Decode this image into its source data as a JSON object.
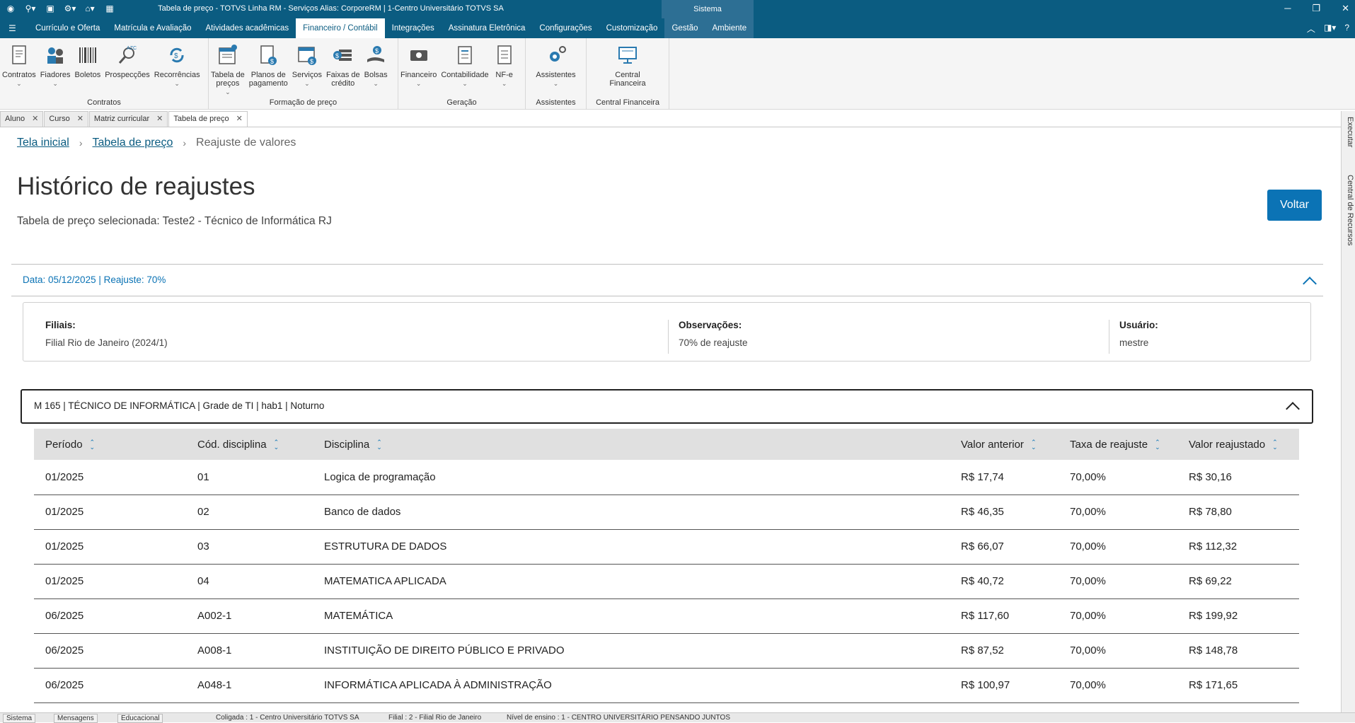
{
  "window": {
    "title": "Tabela de preço - TOTVS Linha RM - Serviços  Alias: CorporeRM | 1-Centro Universitário TOTVS SA",
    "sistema": "Sistema"
  },
  "menu": {
    "tabs": [
      "Currículo e Oferta",
      "Matrícula e Avaliação",
      "Atividades acadêmicas",
      "Financeiro / Contábil",
      "Integrações",
      "Assinatura Eletrônica",
      "Configurações",
      "Customização",
      "Gestão",
      "Ambiente"
    ],
    "active": "Financeiro / Contábil"
  },
  "ribbon": {
    "groups": [
      {
        "label": "Contratos",
        "items": [
          {
            "l1": "Contratos",
            "l2": "",
            "icon": "contract-icon",
            "caret": true
          },
          {
            "l1": "Fiadores",
            "l2": "",
            "icon": "guarantor-icon",
            "caret": true
          },
          {
            "l1": "Boletos",
            "l2": "",
            "icon": "barcode-icon",
            "caret": false
          },
          {
            "l1": "Prospecções",
            "l2": "",
            "icon": "prospect-icon",
            "caret": false
          },
          {
            "l1": "Recorrências",
            "l2": "",
            "icon": "recurrence-icon",
            "caret": true
          }
        ]
      },
      {
        "label": "Formação de preço",
        "items": [
          {
            "l1": "Tabela de",
            "l2": "preços",
            "icon": "price-table-icon",
            "caret": true
          },
          {
            "l1": "Planos de",
            "l2": "pagamento",
            "icon": "payment-plan-icon",
            "caret": false
          },
          {
            "l1": "Serviços",
            "l2": "",
            "icon": "services-icon",
            "caret": true
          },
          {
            "l1": "Faixas de",
            "l2": "crédito",
            "icon": "credit-range-icon",
            "caret": false
          },
          {
            "l1": "Bolsas",
            "l2": "",
            "icon": "scholarship-icon",
            "caret": true
          }
        ]
      },
      {
        "label": "Geração",
        "items": [
          {
            "l1": "Financeiro",
            "l2": "",
            "icon": "finance-icon",
            "caret": true
          },
          {
            "l1": "Contabilidade",
            "l2": "",
            "icon": "accounting-icon",
            "caret": true
          },
          {
            "l1": "NF-e",
            "l2": "",
            "icon": "invoice-icon",
            "caret": true
          }
        ]
      },
      {
        "label": "Assistentes",
        "items": [
          {
            "l1": "Assistentes",
            "l2": "",
            "icon": "wizard-gear-icon",
            "caret": true
          }
        ]
      },
      {
        "label": "Central Financeira",
        "items": [
          {
            "l1": "Central",
            "l2": "Financeira",
            "icon": "monitor-icon",
            "caret": false
          }
        ]
      }
    ]
  },
  "doc_tabs": [
    "Aluno",
    "Curso",
    "Matriz curricular",
    "Tabela de preço"
  ],
  "side_panel": {
    "executar": "Executar",
    "central": "Central de Recursos"
  },
  "breadcrumb": {
    "home": "Tela inicial",
    "parent": "Tabela de preço",
    "current": "Reajuste de valores"
  },
  "page": {
    "title": "Histórico de reajustes",
    "subtitle": "Tabela de preço selecionada: Teste2 - Técnico de Informática RJ",
    "back_label": "Voltar"
  },
  "reajuste": {
    "header": "Data: 05/12/2025 | Reajuste: 70%",
    "filiais_label": "Filiais:",
    "filiais_value": "Filial Rio de Janeiro (2024/1)",
    "obs_label": "Observações:",
    "obs_value": "70% de reajuste",
    "usuario_label": "Usuário:",
    "usuario_value": "mestre"
  },
  "grade": {
    "header": "M 165 | TÉCNICO DE INFORMÁTICA | Grade de TI | hab1 | Noturno",
    "columns": [
      "Período",
      "Cód. disciplina",
      "Disciplina",
      "Valor anterior",
      "Taxa de reajuste",
      "Valor reajustado"
    ],
    "rows": [
      [
        "01/2025",
        "01",
        "Logica de programação",
        "R$ 17,74",
        "70,00%",
        "R$ 30,16"
      ],
      [
        "01/2025",
        "02",
        "Banco de dados",
        "R$ 46,35",
        "70,00%",
        "R$ 78,80"
      ],
      [
        "01/2025",
        "03",
        "ESTRUTURA DE DADOS",
        "R$ 66,07",
        "70,00%",
        "R$ 112,32"
      ],
      [
        "01/2025",
        "04",
        "MATEMATICA APLICADA",
        "R$ 40,72",
        "70,00%",
        "R$ 69,22"
      ],
      [
        "06/2025",
        "A002-1",
        "MATEMÁTICA",
        "R$ 117,60",
        "70,00%",
        "R$ 199,92"
      ],
      [
        "06/2025",
        "A008-1",
        "INSTITUIÇÃO DE DIREITO PÚBLICO E PRIVADO",
        "R$ 87,52",
        "70,00%",
        "R$ 148,78"
      ],
      [
        "06/2025",
        "A048-1",
        "INFORMÁTICA APLICADA À ADMINISTRAÇÃO",
        "R$ 100,97",
        "70,00%",
        "R$ 171,65"
      ]
    ]
  },
  "statusbar": {
    "sistema": "Sistema",
    "mensagens": "Mensagens",
    "educacional": "Educacional",
    "coligada": "Coligada : 1 - Centro Universitário TOTVS SA",
    "filial": "Filial : 2 - Filial Rio de Janeiro",
    "nivel": "Nível de ensino : 1 - CENTRO UNIVERSITÁRIO PENSANDO JUNTOS"
  },
  "colors": {
    "brand": "#0b5c81",
    "accent": "#0b73b5"
  }
}
